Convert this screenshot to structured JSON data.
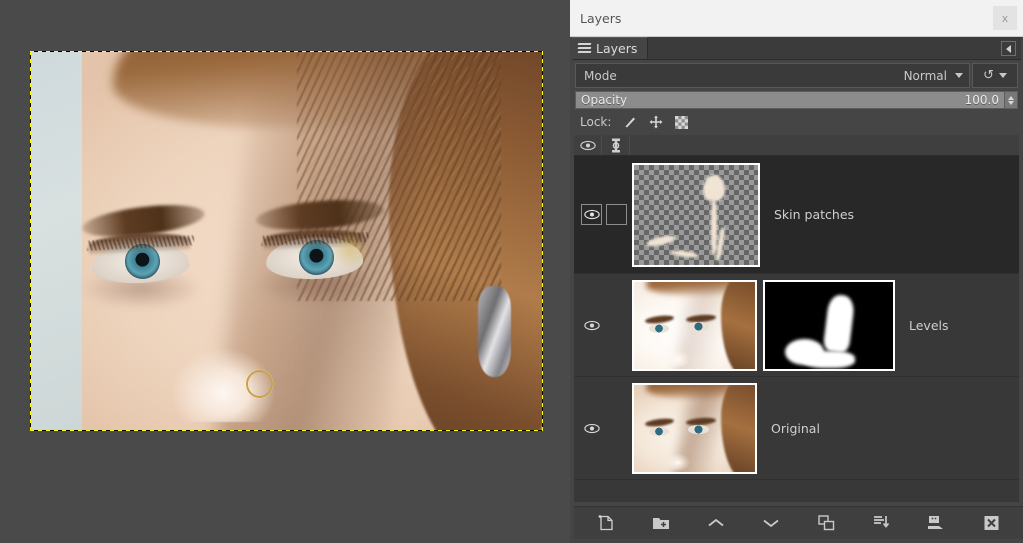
{
  "window": {
    "title": "Layers",
    "close_label": "x"
  },
  "dock": {
    "tab_label": "Layers",
    "tab_icon": "layers-icon",
    "tab_menu_icon": "tab-menu-arrow-icon"
  },
  "mode": {
    "label": "Mode",
    "value": "Normal",
    "dropdown_icon": "chevron-down-icon",
    "reset_icon": "reset-icon",
    "reset_dropdown_icon": "chevron-down-icon"
  },
  "opacity": {
    "label": "Opacity",
    "value": "100.0",
    "percent": 100,
    "spinner_up_icon": "spinner-up-icon",
    "spinner_down_icon": "spinner-down-icon"
  },
  "lock": {
    "label": "Lock:",
    "items": [
      {
        "name": "lock-pixels",
        "icon": "brush-icon"
      },
      {
        "name": "lock-position",
        "icon": "move-cross-icon"
      },
      {
        "name": "lock-alpha",
        "icon": "checkerboard-icon"
      }
    ]
  },
  "list_header": {
    "visibility_icon": "eye-icon",
    "link_icon": "chain-link-icon"
  },
  "layers": [
    {
      "name": "Skin patches",
      "visible": true,
      "linked": false,
      "selected": true,
      "thumbnail": "transparent-skin-patches",
      "has_mask": false
    },
    {
      "name": "Levels",
      "visible": true,
      "linked": false,
      "selected": false,
      "thumbnail": "bright-face",
      "has_mask": true,
      "mask_thumbnail": "black-white-mask"
    },
    {
      "name": "Original",
      "visible": true,
      "linked": false,
      "selected": false,
      "thumbnail": "original-face",
      "has_mask": false
    }
  ],
  "bottom_toolbar": [
    {
      "name": "new-layer-button",
      "icon": "new-layer-icon",
      "label": "New Layer"
    },
    {
      "name": "new-layer-group-button",
      "icon": "new-layer-group-icon",
      "label": "New Layer Group"
    },
    {
      "name": "raise-layer-button",
      "icon": "chevron-up-icon",
      "label": "Raise Layer"
    },
    {
      "name": "lower-layer-button",
      "icon": "chevron-down-icon",
      "label": "Lower Layer"
    },
    {
      "name": "duplicate-layer-button",
      "icon": "duplicate-icon",
      "label": "Duplicate Layer"
    },
    {
      "name": "anchor-layer-button",
      "icon": "anchor-icon",
      "label": "Anchor Layer"
    },
    {
      "name": "merge-down-button",
      "icon": "merge-down-icon",
      "label": "Merge Down"
    },
    {
      "name": "delete-layer-button",
      "icon": "delete-x-icon",
      "label": "Delete Layer"
    }
  ],
  "canvas": {
    "selection": "marching-ants-rectangle",
    "image_description": "close-up portrait photo of a woman's face with eyes, eyebrows, nose ring and earring"
  },
  "colors": {
    "dock_bg": "#454545",
    "row_bg": "#383838",
    "row_selected_bg": "#282828",
    "titlebar_bg": "#f2f2f2",
    "text": "#cfcfcf",
    "canvas_bg": "#4a4a4a",
    "selection_a": "#ffff00",
    "selection_b": "#000000"
  }
}
